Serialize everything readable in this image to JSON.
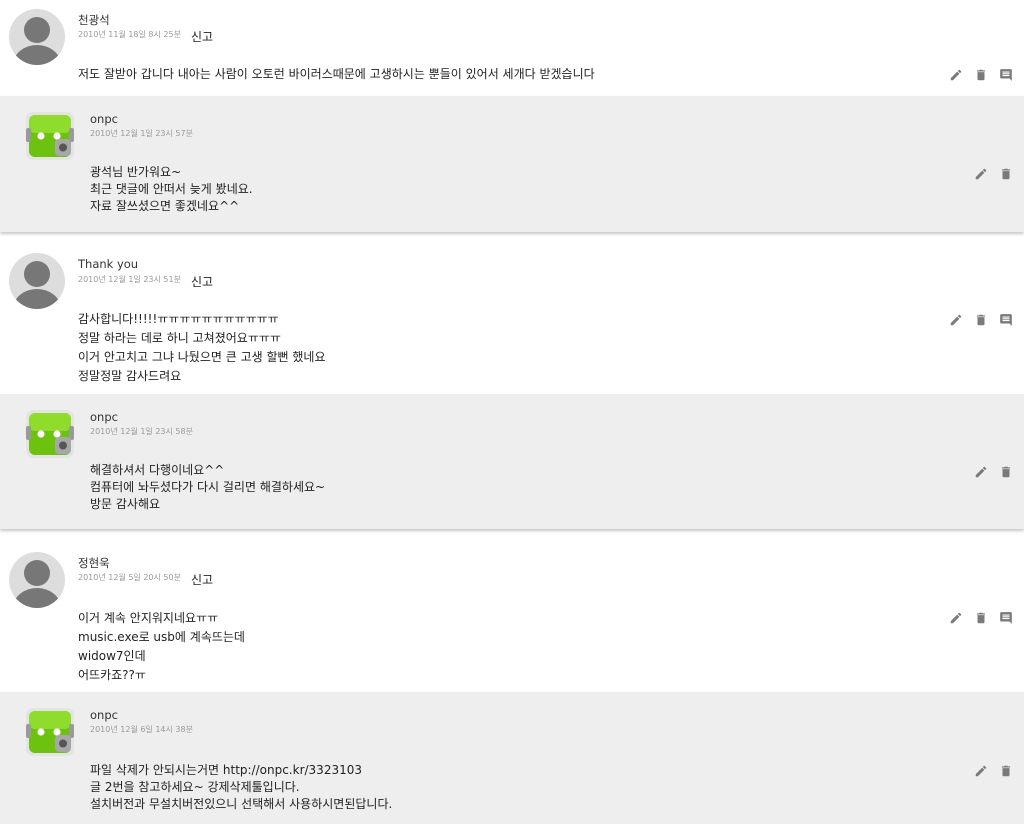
{
  "threads": [
    {
      "comment": {
        "author": "천광석",
        "date": "2010년 11월 18일 8시 25분",
        "report": "신고",
        "lines": [
          "저도 잘받아 갑니다 내아는 사람이 오토런 바이러스때문에 고생하시는 뿐들이 있어서 세개다 받겠습니다"
        ]
      },
      "reply": {
        "author": "onpc",
        "date": "2010년 12월 1일 23시 57분",
        "lines": [
          "광석님 반가워요~",
          "최근 댓글에 안떠서 늦게 봤네요.",
          "자료 잘쓰셨으면 좋겠네요^^"
        ]
      }
    },
    {
      "comment": {
        "author": "Thank you",
        "date": "2010년 12월 1일 23시 51분",
        "report": "신고",
        "lines": [
          "감사합니다!!!!!ㅠㅠㅠㅠㅠㅠㅠㅠㅠㅠㅠ",
          "정말 하라는 데로 하니 고쳐졌어요ㅠㅠㅠ",
          "이거 안고치고 그냐 나뒀으면 큰 고생 할뻔 했네요",
          "정말정말 감사드려요"
        ]
      },
      "reply": {
        "author": "onpc",
        "date": "2010년 12월 1일 23시 58분",
        "lines": [
          "해결하셔서 다행이네요^^",
          "컴퓨터에 놔두셨다가 다시 걸리면 해결하세요~",
          "방문 감사해요"
        ]
      }
    },
    {
      "comment": {
        "author": "정현욱",
        "date": "2010년 12월 5일 20시 50분",
        "report": "신고",
        "lines": [
          "이거 계속 안지워지네요ㅠㅠ",
          "music.exe로 usb에 계속뜨는데",
          "widow7인데",
          "어뜨카죠??ㅠ"
        ]
      },
      "reply": {
        "author": "onpc",
        "date": "2010년 12월 6일 14시 38분",
        "lines": [
          "파일 삭제가 안되시는거면 http://onpc.kr/3323103",
          "글 2번을 참고하세요~ 강제삭제툴입니다.",
          "설치버전과 무설치버전있으니 선택해서 사용하시면된답니다."
        ]
      }
    }
  ],
  "icons": {
    "edit": "pencil-icon",
    "delete": "trash-icon",
    "reply": "comment-icon"
  },
  "colors": {
    "reply_background": "#eeeeee",
    "action_icon": "#7a7a7a",
    "robot_green": "#6cc20f"
  }
}
